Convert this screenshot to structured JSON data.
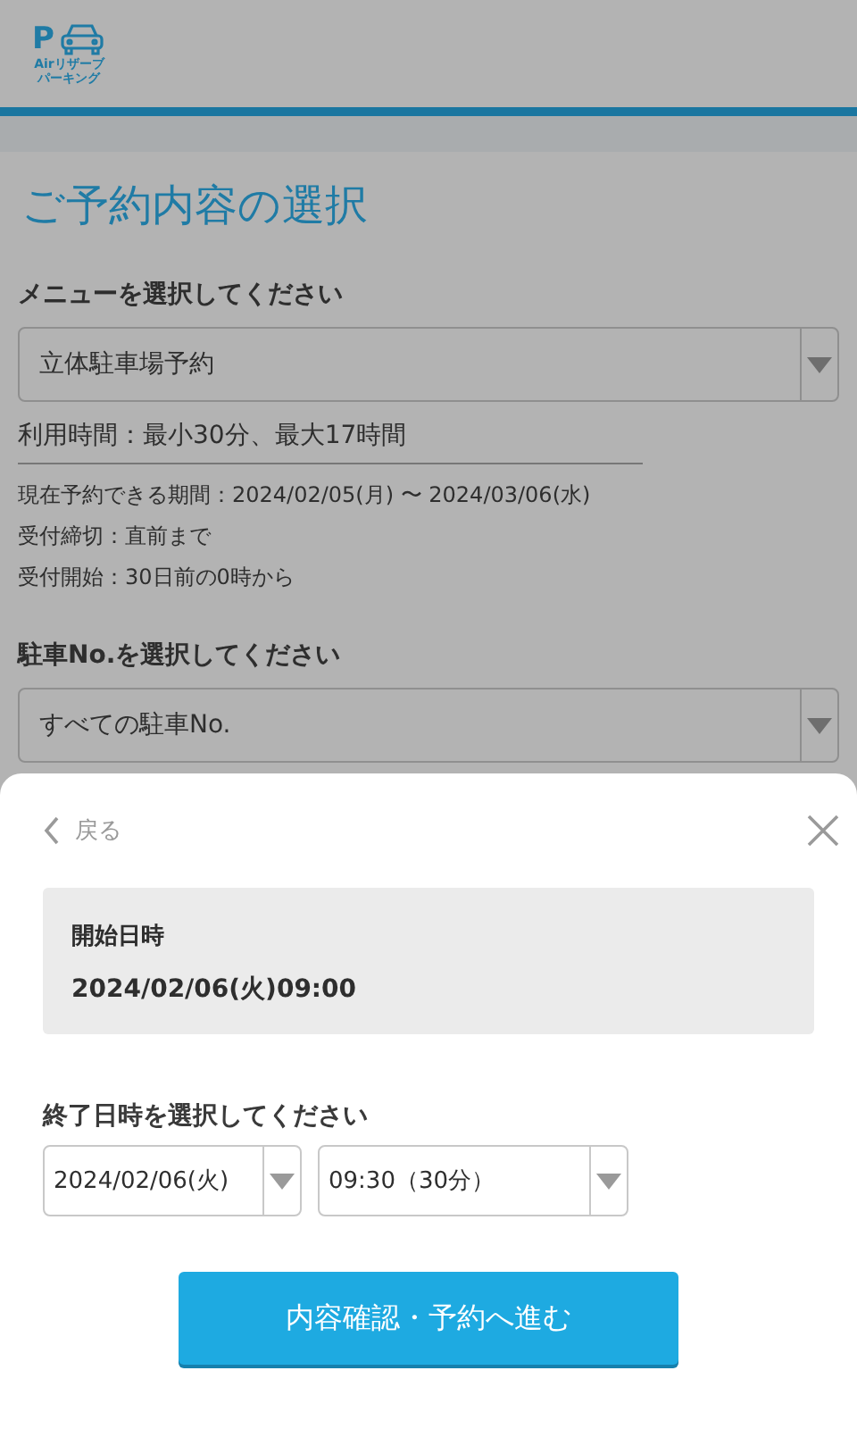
{
  "header": {
    "logo_mark": "P",
    "logo_lines": [
      "Airリザーブ",
      "パーキング"
    ]
  },
  "page": {
    "title": "ご予約内容の選択",
    "menu_label": "メニューを選択してください",
    "menu_select": {
      "value": "立体駐車場予約"
    },
    "usage_time": "利用時間：最小30分、最大17時間",
    "notes": [
      "現在予約できる期間：2024/02/05(月) 〜 2024/03/06(水)",
      "受付締切：直前まで",
      "受付開始：30日前の0時から"
    ],
    "space_label": "駐車No.を選択してください",
    "space_select": {
      "value": "すべての駐車No."
    }
  },
  "sheet": {
    "back": "戻る",
    "start": {
      "label": "開始日時",
      "value": "2024/02/06(火)09:00"
    },
    "end_label": "終了日時を選択してください",
    "end_date": {
      "value": "2024/02/06(火)"
    },
    "end_time": {
      "value": "09:30（30分）"
    },
    "submit": "内容確認・予約へ進む"
  }
}
